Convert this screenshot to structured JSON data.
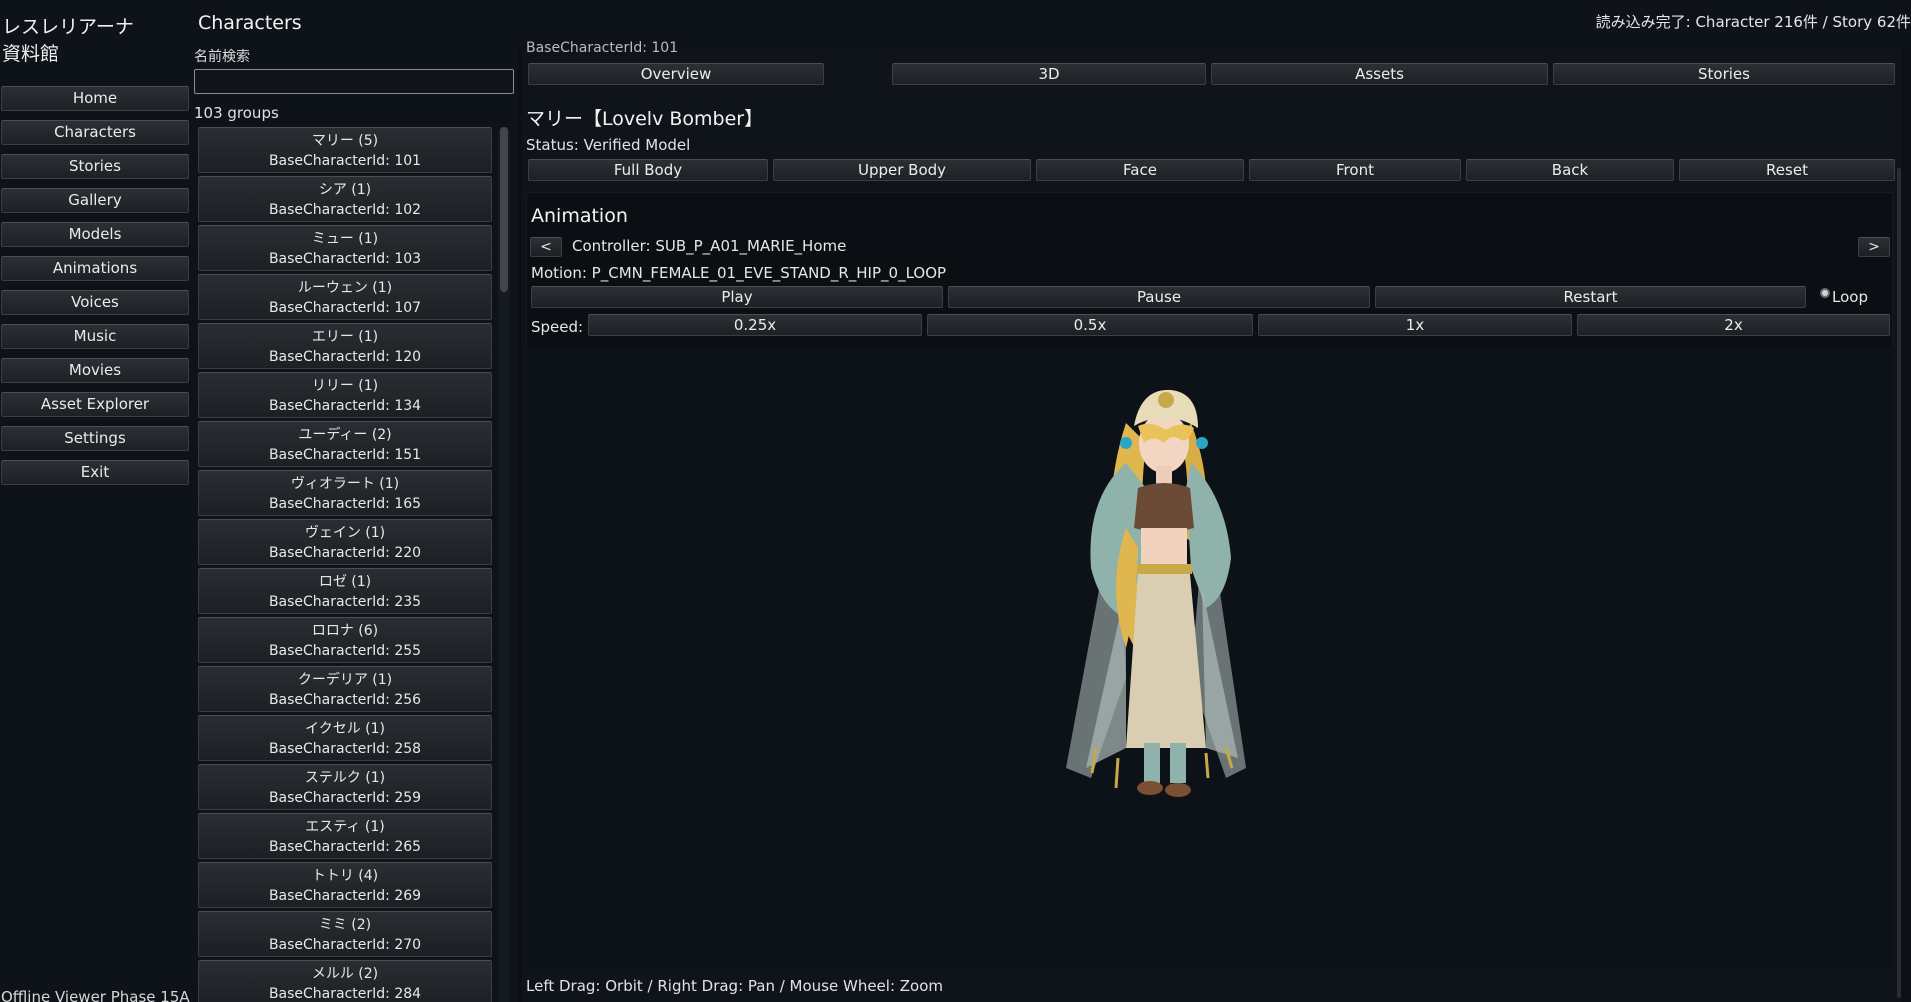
{
  "app": {
    "title": "レスレリアーナ\n資料館",
    "version": "Offline Viewer Phase 15A",
    "status": "読み込み完了: Character 216件 / Story 62件"
  },
  "nav": [
    "Home",
    "Characters",
    "Stories",
    "Gallery",
    "Models",
    "Animations",
    "Voices",
    "Music",
    "Movies",
    "Asset Explorer",
    "Settings",
    "Exit"
  ],
  "list": {
    "title": "Characters",
    "search_label": "名前検索",
    "search_value": "",
    "group_count": "103 groups",
    "groups": [
      {
        "name": "マリー (5)",
        "id": "BaseCharacterId: 101"
      },
      {
        "name": "シア (1)",
        "id": "BaseCharacterId: 102"
      },
      {
        "name": "ミュー (1)",
        "id": "BaseCharacterId: 103"
      },
      {
        "name": "ルーウェン (1)",
        "id": "BaseCharacterId: 107"
      },
      {
        "name": "エリー (1)",
        "id": "BaseCharacterId: 120"
      },
      {
        "name": "リリー (1)",
        "id": "BaseCharacterId: 134"
      },
      {
        "name": "ユーディー (2)",
        "id": "BaseCharacterId: 151"
      },
      {
        "name": "ヴィオラート (1)",
        "id": "BaseCharacterId: 165"
      },
      {
        "name": "ヴェイン (1)",
        "id": "BaseCharacterId: 220"
      },
      {
        "name": "ロゼ (1)",
        "id": "BaseCharacterId: 235"
      },
      {
        "name": "ロロナ (6)",
        "id": "BaseCharacterId: 255"
      },
      {
        "name": "クーデリア (1)",
        "id": "BaseCharacterId: 256"
      },
      {
        "name": "イクセル (1)",
        "id": "BaseCharacterId: 258"
      },
      {
        "name": "ステルク (1)",
        "id": "BaseCharacterId: 259"
      },
      {
        "name": "エスティ (1)",
        "id": "BaseCharacterId: 265"
      },
      {
        "name": "トトリ (4)",
        "id": "BaseCharacterId: 269"
      },
      {
        "name": "ミミ (2)",
        "id": "BaseCharacterId: 270"
      },
      {
        "name": "メルル (2)",
        "id": "BaseCharacterId: 284"
      }
    ]
  },
  "detail": {
    "prev_line": "BaseCharacterId: 101",
    "tabs": [
      "Overview",
      "3D",
      "Assets",
      "Stories"
    ],
    "name": "マリー【Lovelv Bomber】",
    "status": "Status: Verified Model",
    "view_buttons": [
      "Full Body",
      "Upper Body",
      "Face",
      "Front",
      "Back",
      "Reset"
    ]
  },
  "animation": {
    "title": "Animation",
    "prev": "<",
    "next": ">",
    "controller": "Controller: SUB_P_A01_MARIE_Home",
    "motion": "Motion: P_CMN_FEMALE_01_EVE_STAND_R_HIP_0_LOOP",
    "controls": [
      "Play",
      "Pause",
      "Restart"
    ],
    "loop_label": "Loop",
    "loop_checked": true,
    "speed_label": "Speed:",
    "speeds": [
      "0.25x",
      "0.5x",
      "1x",
      "2x"
    ]
  },
  "viewport": {
    "hint": "Left Drag: Orbit / Right Drag: Pan / Mouse Wheel: Zoom"
  },
  "colors": {
    "background": "#0c1016",
    "button": "#25282d",
    "text": "#e6e6e6",
    "hair": "#e8c261",
    "outfit": "#9bb8b0",
    "skirt": "#d9cdb2"
  }
}
